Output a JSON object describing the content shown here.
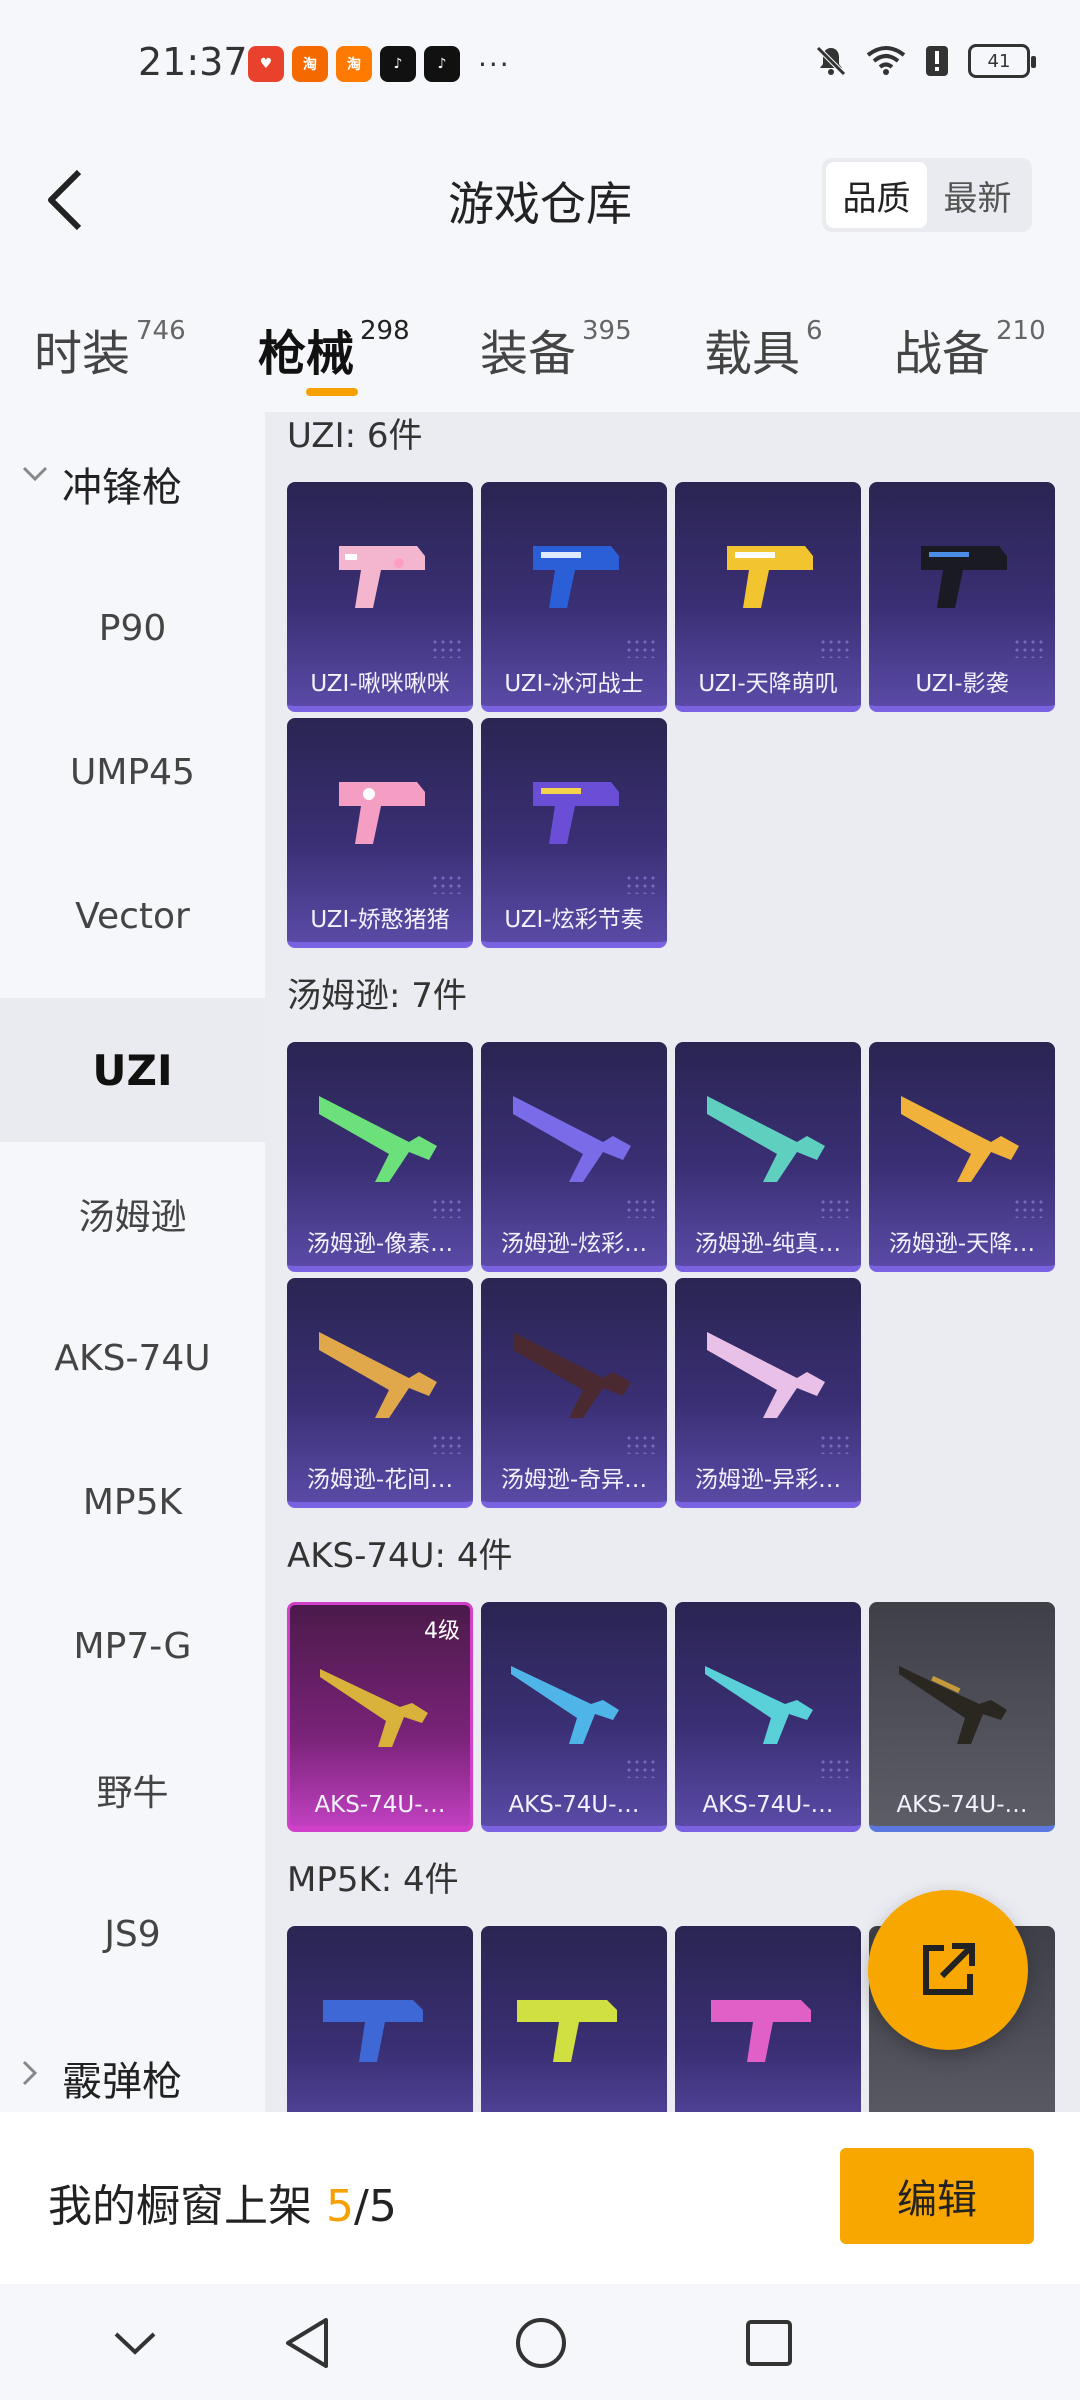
{
  "status": {
    "time": "21:37",
    "battery": "41",
    "more": "···"
  },
  "header": {
    "title": "游戏仓库",
    "sort_quality": "品质",
    "sort_newest": "最新"
  },
  "tabs": [
    {
      "label": "时装",
      "count": "746"
    },
    {
      "label": "枪械",
      "count": "298"
    },
    {
      "label": "装备",
      "count": "395"
    },
    {
      "label": "载具",
      "count": "6"
    },
    {
      "label": "战备",
      "count": "210"
    }
  ],
  "sidebar": {
    "group_smg": "冲锋枪",
    "items": [
      "P90",
      "UMP45",
      "Vector",
      "UZI",
      "汤姆逊",
      "AKS-74U",
      "MP5K",
      "MP7-G",
      "野牛",
      "JS9"
    ],
    "group_shotgun": "霰弹枪"
  },
  "sections": {
    "uzi": {
      "title": "UZI: 6件",
      "items": [
        "UZI-啾咪啾咪",
        "UZI-冰河战士",
        "UZI-天降萌叽",
        "UZI-影袭",
        "UZI-娇憨猪猪",
        "UZI-炫彩节奏"
      ]
    },
    "thompson": {
      "title": "汤姆逊: 7件",
      "items": [
        "汤姆逊-像素…",
        "汤姆逊-炫彩…",
        "汤姆逊-纯真…",
        "汤姆逊-天降…",
        "汤姆逊-花间…",
        "汤姆逊-奇异…",
        "汤姆逊-异彩…"
      ]
    },
    "aks": {
      "title": "AKS-74U: 4件",
      "items": [
        "AKS-74U-…",
        "AKS-74U-…",
        "AKS-74U-…",
        "AKS-74U-…"
      ],
      "badge": "4级"
    },
    "mp5k": {
      "title": "MP5K: 4件"
    }
  },
  "bottom": {
    "showcase_label": "我的橱窗上架 ",
    "count": "5",
    "total": "/5",
    "edit": "编辑"
  },
  "colors": {
    "accent": "#f7a700",
    "card": "#3a2f74"
  }
}
